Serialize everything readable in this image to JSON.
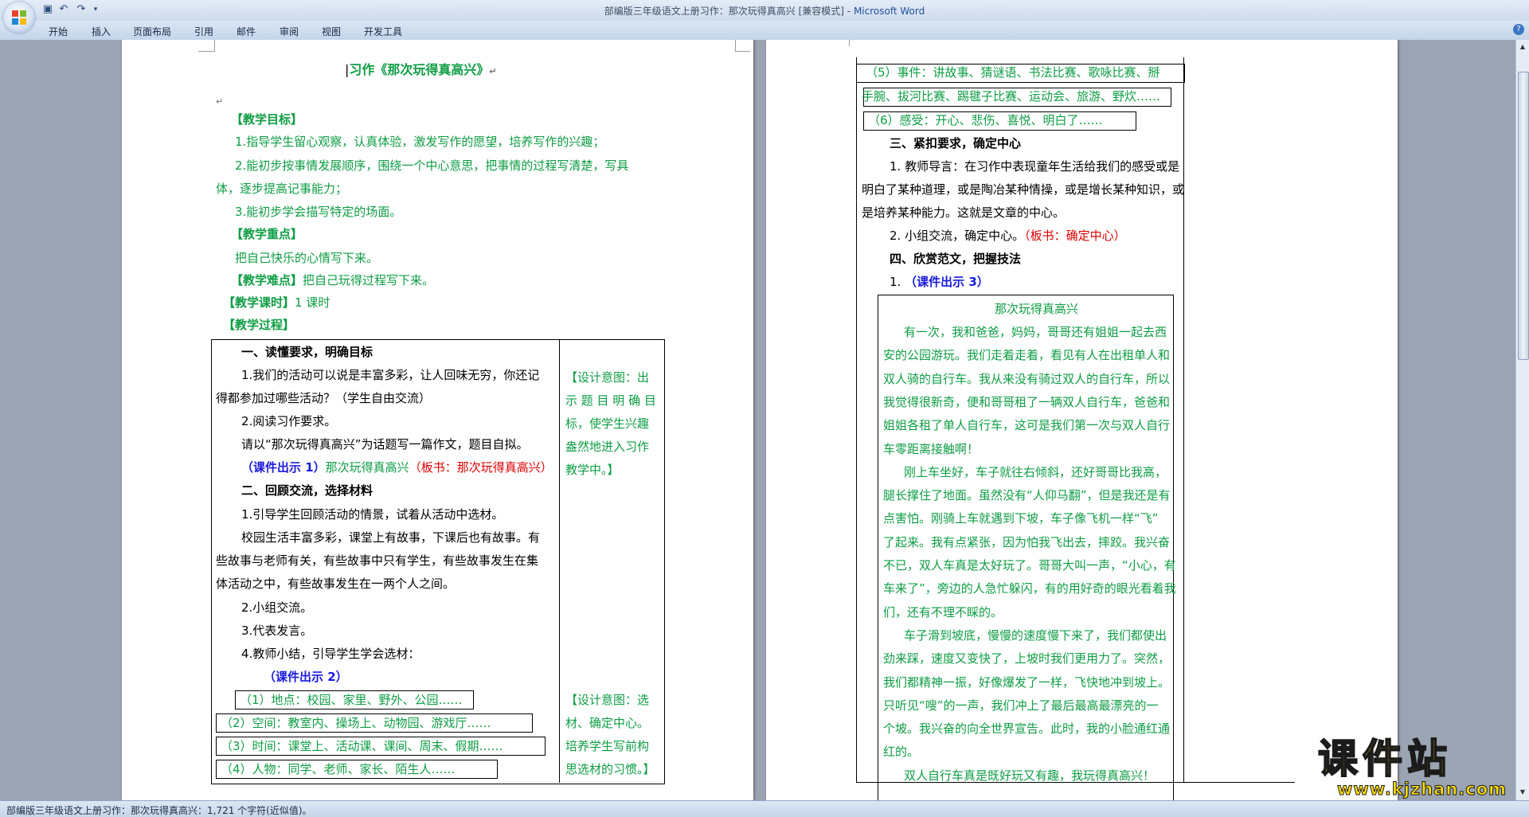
{
  "window": {
    "title": "部编版三年级语文上册习作：那次玩得真高兴 [兼容模式]",
    "app_name": "Microsoft Word",
    "title_separator": " - "
  },
  "ribbon": {
    "tabs": [
      "开始",
      "插入",
      "页面布局",
      "引用",
      "邮件",
      "审阅",
      "视图",
      "开发工具"
    ]
  },
  "status": {
    "text": "部编版三年级语文上册习作：那次玩得真高兴：1,721 个字符(近似值)。"
  },
  "page1": {
    "title": "习作《那次玩得真高兴》",
    "goals_heading": "【教学目标】",
    "goal1": "1.指导学生留心观察，认真体验，激发写作的愿望，培养写作的兴趣；",
    "goal2a": "2.能初步按事情发展顺序，围绕一个中心意思，把事情的过程写清楚，写具",
    "goal2b": "体，逐步提高记事能力；",
    "goal3": "3.能初步学会描写特定的场面。",
    "key_heading": "【教学重点】",
    "key_text": "把自己快乐的心情写下来。",
    "diff_heading": "【教学难点】",
    "diff_text": "把自己玩得过程写下来。",
    "time_heading": "【教学课时】",
    "time_text": "1 课时",
    "process_heading": "【教学过程】",
    "sec1_title": "一、读懂要求，明确目标",
    "s1_p1a": "1.我们的活动可以说是丰富多彩，让人回味无穷，你还记",
    "s1_p1b": "得都参加过哪些活动？（学生自由交流）",
    "s1_p2": "2.阅读习作要求。",
    "s1_p3": "请以“那次玩得真高兴”为话题写一篇作文，题目自拟。",
    "s1_p4_blue": "（课件出示 1）",
    "s1_p4_green": "那次玩得真高兴",
    "s1_p4_red": "（板书：那次玩得真高兴）",
    "sec2_title": "二、回顾交流，选择材料",
    "s2_p1": "1.引导学生回顾活动的情景，试着从活动中选材。",
    "s2_p2a": "校园生活丰富多彩，课堂上有故事，下课后也有故事。有",
    "s2_p2b": "些故事与老师有关，有些故事中只有学生，有些故事发生在集",
    "s2_p2c": "体活动之中，有些故事发生在一两个人之间。",
    "s2_p3": "2.小组交流。",
    "s2_p4": "3.代表发言。",
    "s2_p5": "4.教师小结，引导学生学会选材：",
    "s2_p6": "（课件出示 2）",
    "opt1": "（1）地点：校园、家里、野外、公园……",
    "opt2": "（2）空间：教室内、操场上、动物园、游戏厅……",
    "opt3": "（3）时间：课堂上、活动课、课间、周末、假期……",
    "opt4": "（4）人物：同学、老师、家长、陌生人……",
    "design1": [
      "【设计意图：出",
      "示 题 目 明 确 目",
      "标，使学生兴趣",
      "盎然地进入习作",
      "教学中。】"
    ],
    "design2": [
      "【设计意图：选",
      "材、确定中心。",
      "培养学生写前构",
      "思选材的习惯。】"
    ]
  },
  "page2": {
    "opt5a": "（5）事件：讲故事、猜谜语、书法比赛、歌咏比赛、掰",
    "opt5b": "手腕、拔河比赛、踢毽子比赛、运动会、旅游、野炊……",
    "opt6": "（6）感受：开心、悲伤、喜悦、明白了……",
    "sec3_title": "三、紧扣要求，确定中心",
    "s3_p1a": "1. 教师导言：在习作中表现童年生活给我们的感受或是",
    "s3_p1b": "明白了某种道理，或是陶冶某种情操，或是增长某种知识，或",
    "s3_p1c": "是培养某种能力。这就是文章的中心。",
    "s3_p2": "2. 小组交流，确定中心。",
    "s3_p2_red": "（板书：确定中心）",
    "sec4_title": "四、欣赏范文，把握技法",
    "s4_p1_num": "1. ",
    "s4_p1_blue": "（课件出示 3）",
    "essay_title": "那次玩得真高兴",
    "essay_lines": [
      "有一次，我和爸爸，妈妈，哥哥还有姐姐一起去西",
      "安的公园游玩。我们走着走着，看见有人在出租单人和",
      "双人骑的自行车。我从来没有骑过双人的自行车，所以",
      "我觉得很新奇，便和哥哥租了一辆双人自行车，爸爸和",
      "姐姐各租了单人自行车，这可是我们第一次与双人自行",
      "车零距离接触啊！",
      "刚上车坐好，车子就往右倾斜，还好哥哥比我高，",
      "腿长撑住了地面。虽然没有“人仰马翻”，但是我还是有",
      "点害怕。刚骑上车就遇到下坡，车子像飞机一样“飞”",
      "了起来。我有点紧张，因为怕我飞出去，摔跤。我兴奋",
      "不已，双人车真是太好玩了。哥哥大叫一声，“小心，有",
      "车来了”，旁边的人急忙躲闪，有的用好奇的眼光看着我",
      "们，还有不理不睬的。",
      "车子滑到坡底，慢慢的速度慢下来了，我们都使出",
      "劲来踩，速度又变快了，上坡时我们更用力了。突然，",
      "我们都精神一振，好像爆发了一样，飞快地冲到坡上。",
      "只听见“嗖”的一声，我们冲上了最后最高最漂亮的一",
      "个坡。我兴奋的向全世界宣告。此时，我的小脸通红通",
      "红的。",
      "双人自行车真是既好玩又有趣，我玩得真高兴！"
    ]
  },
  "watermark": {
    "main": "课件站",
    "url": "www.kjzhan.com"
  },
  "paragraph_mark": "↵",
  "colors": {
    "green": "#0e9d44",
    "blue": "#1a1ae0",
    "red": "#e00000",
    "yellow": "#ffdd00"
  }
}
